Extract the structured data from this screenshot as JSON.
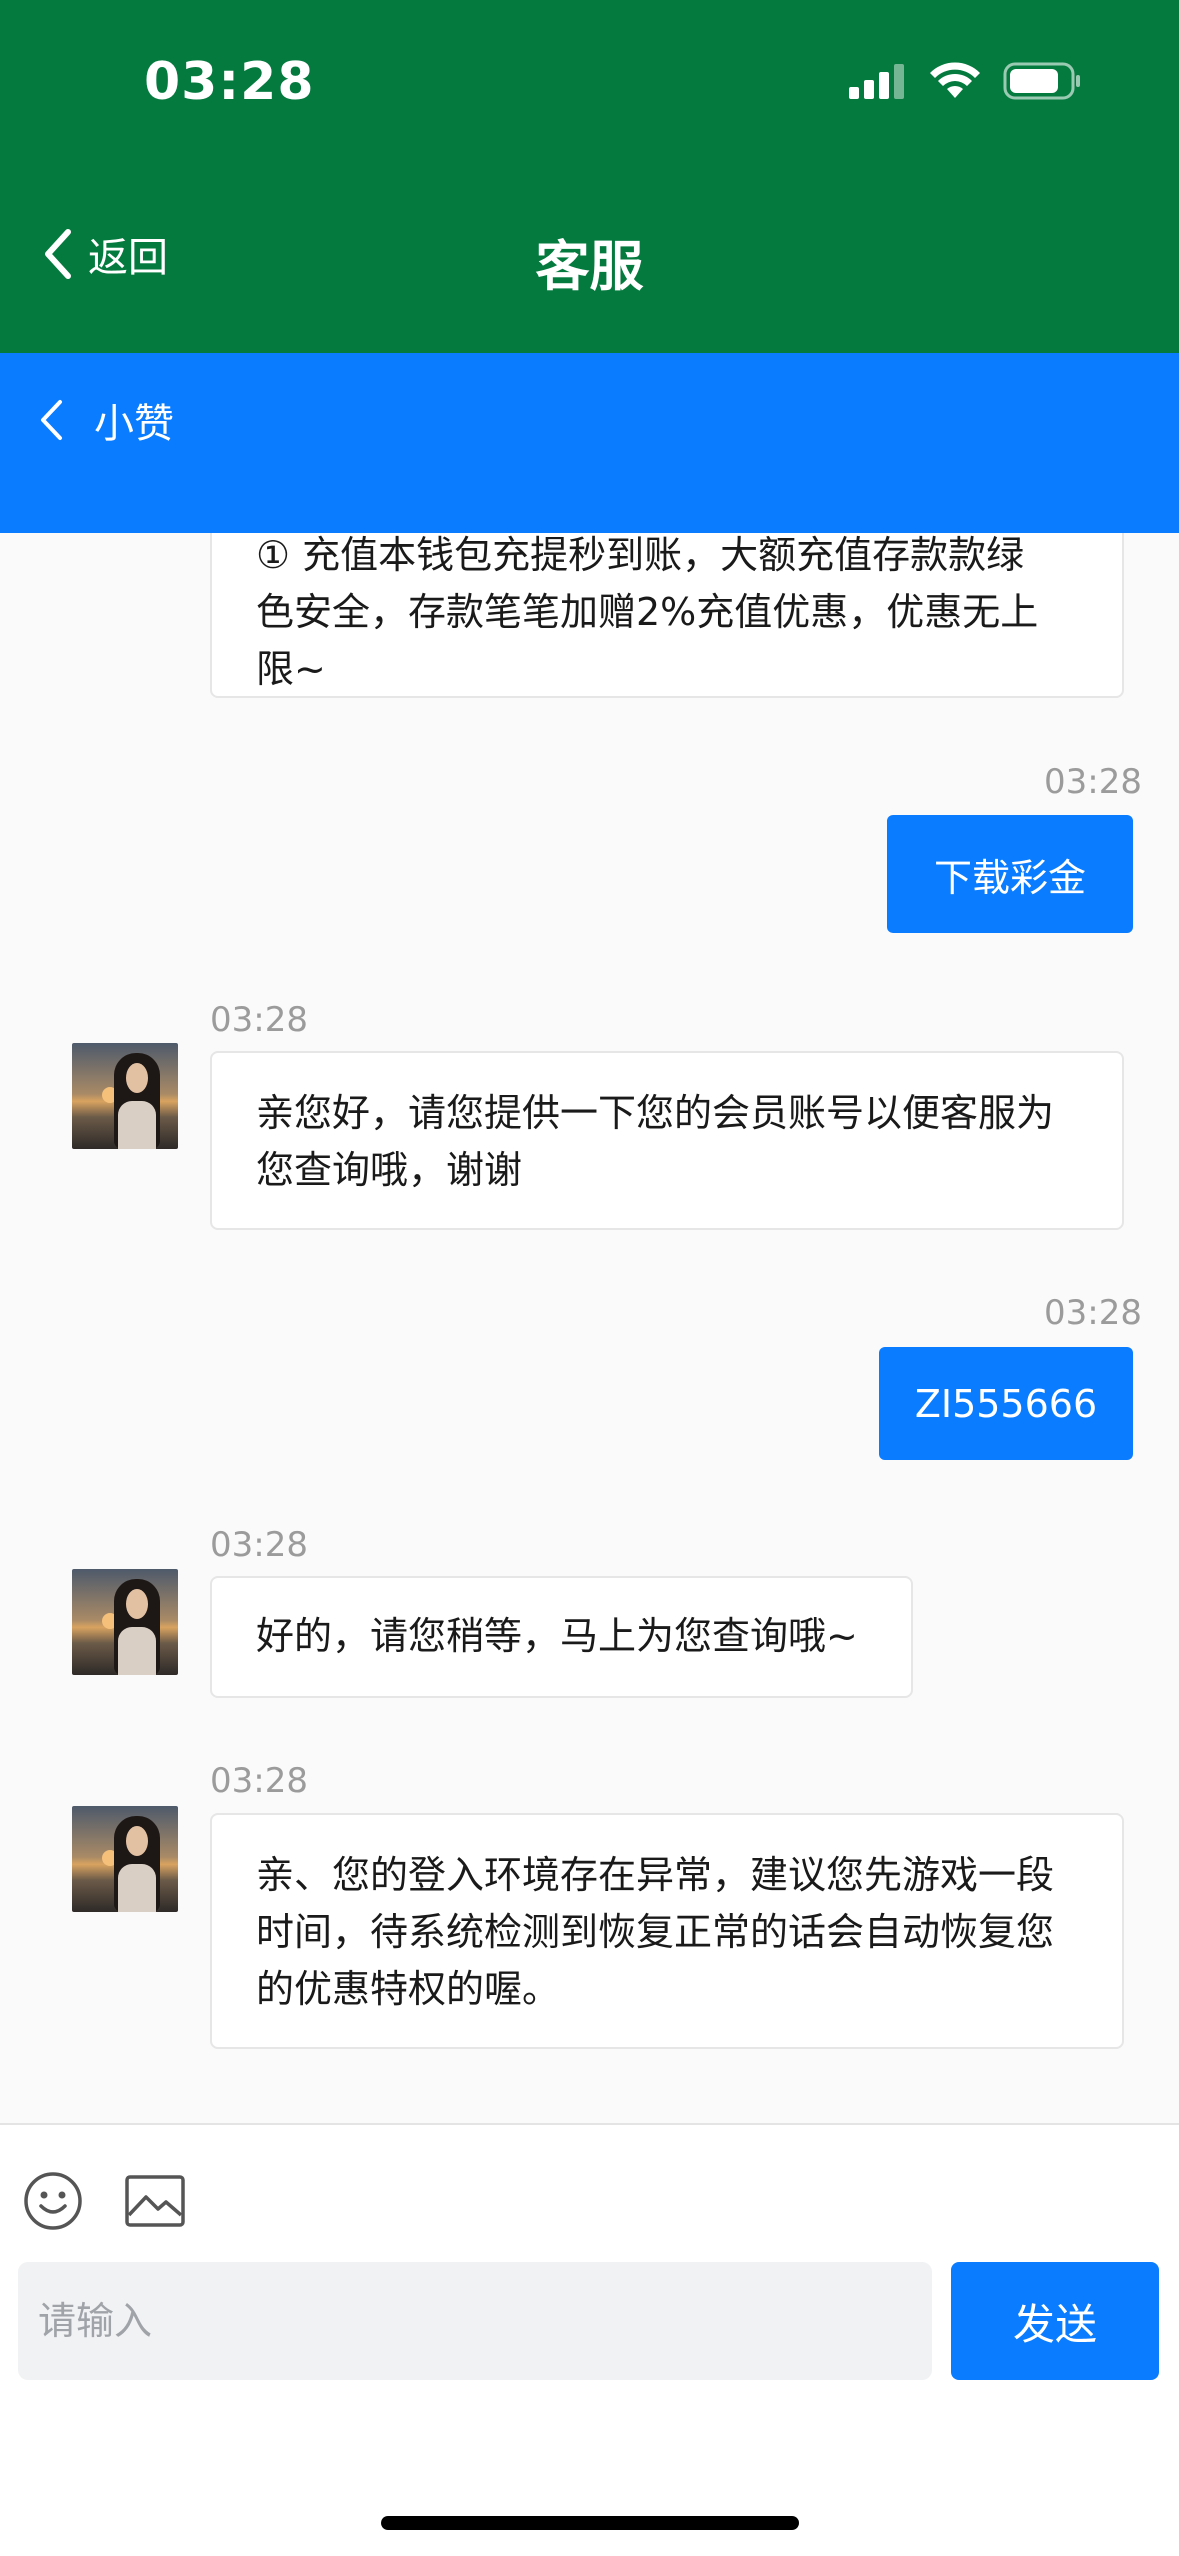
{
  "status_bar": {
    "time": "03:28"
  },
  "nav": {
    "back_label": "返回",
    "title": "客服"
  },
  "sub_header": {
    "title": "小赞"
  },
  "messages": [
    {
      "from": "agent",
      "text_lines": [
        "① 充值本钱包充提秒到账，大额充值存款款绿",
        "色安全，存款笔笔加赠2%充值优惠，优惠无上",
        "限~"
      ]
    },
    {
      "from": "user",
      "time": "03:28",
      "text": "下载彩金"
    },
    {
      "from": "agent",
      "time": "03:28",
      "text_lines": [
        "亲您好，请您提供一下您的会员账号以便客服为",
        "您查询哦，谢谢"
      ]
    },
    {
      "from": "user",
      "time": "03:28",
      "text": "ZI555666"
    },
    {
      "from": "agent",
      "time": "03:28",
      "text_lines": [
        "好的，请您稍等，马上为您查询哦~"
      ]
    },
    {
      "from": "agent",
      "time": "03:28",
      "text_lines": [
        "亲、您的登入环境存在异常，建议您先游戏一段",
        "时间，待系统检测到恢复正常的话会自动恢复您",
        "的优惠特权的喔。"
      ]
    }
  ],
  "composer": {
    "placeholder": "请输入",
    "send_label": "发送"
  },
  "icons": {
    "emoji": "smiley-icon",
    "image": "image-icon"
  },
  "colors": {
    "header_green": "#057a3f",
    "accent_blue": "#0a7cff"
  }
}
